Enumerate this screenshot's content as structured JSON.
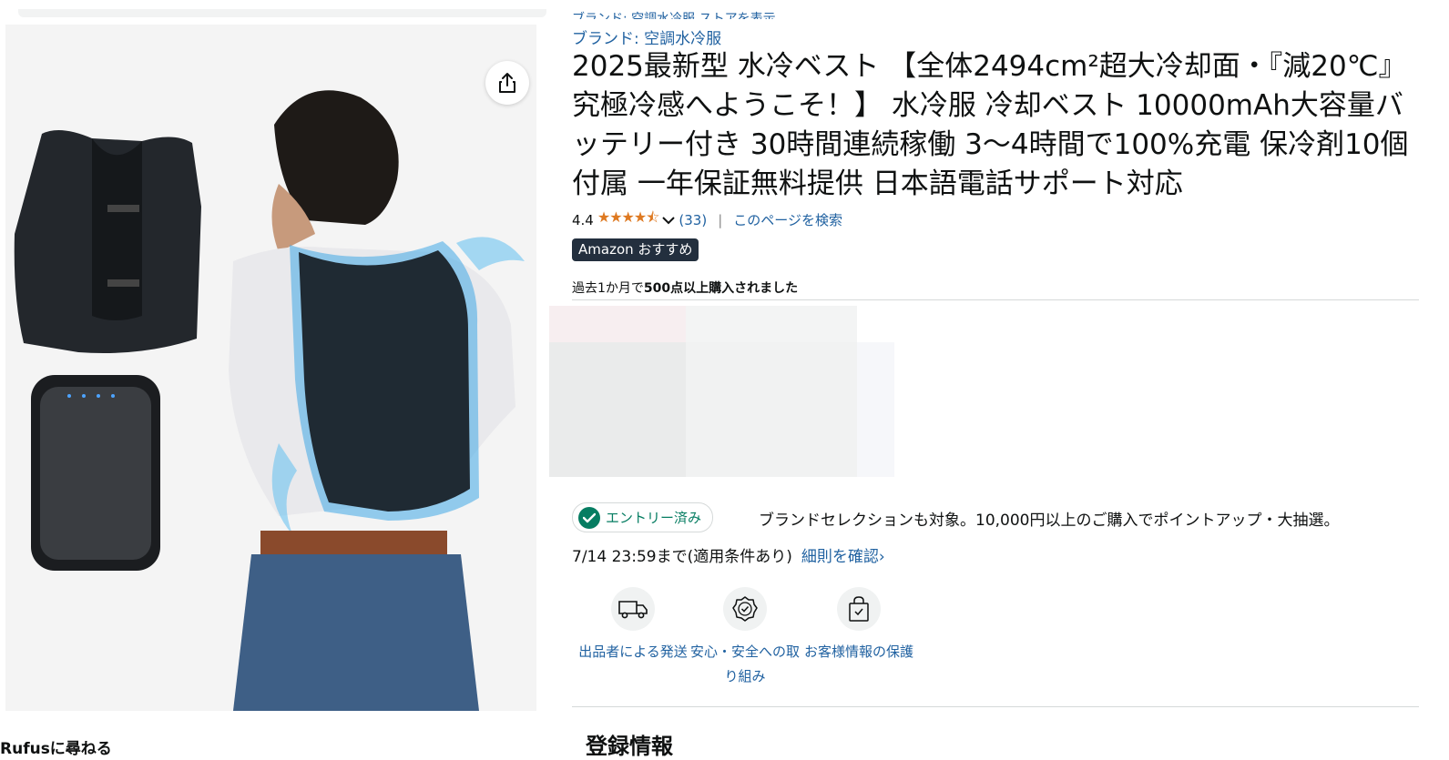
{
  "gallery": {
    "share_icon": "share-icon",
    "rufus_text": "Rufusに尋ねる"
  },
  "product": {
    "brand_clipped": "ブランド: 空調水冷服 ストアを表示",
    "brand": "ブランド: 空調水冷服",
    "title": "2025最新型 水冷ベスト 【全体2494cm²超大冷却面・『減20℃』究極冷感へようこそ！】 水冷服 冷却ベスト 10000mAh大容量バッテリー付き 30時間連続稼働 3〜4時間で100%充電 保冷剤10個付属 一年保証無料提供 日本語電話サポート対応",
    "rating": "4.4",
    "stars": "★★★★⯪",
    "review_count": "(33)",
    "search_page": "このページを検索",
    "badge": "Amazon おすすめ",
    "bought_prefix": "過去1か月で",
    "bought_bold": "500点以上購入されました"
  },
  "promotion": {
    "entry_status": "エントリー済み",
    "text": "ブランドセレクションも対象。10,000円以上のご購入でポイントアップ・大抽選。",
    "date": "7/14 23:59まで(適用条件あり)",
    "rules_link": "細則を確認›"
  },
  "features": [
    {
      "label": "出品者による発送",
      "icon": "truck-icon"
    },
    {
      "label": "安心・安全への取り組み",
      "icon": "badge-check-icon"
    },
    {
      "label": "お客様情報の保護",
      "icon": "shopping-bag-lock-icon"
    }
  ],
  "registration": {
    "heading": "登録情報"
  },
  "colors": {
    "link": "#2162a1",
    "star": "#de7921",
    "badge_bg": "#232f3e",
    "success": "#067d62"
  }
}
